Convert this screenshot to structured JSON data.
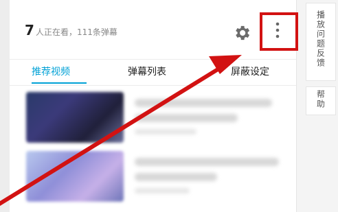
{
  "header": {
    "viewer_count": "7",
    "viewer_text": "人正在看，111条弹幕"
  },
  "tabs": [
    {
      "label": "推荐视频",
      "active": true
    },
    {
      "label": "弹幕列表",
      "active": false
    },
    {
      "label": "屏蔽设定",
      "active": false
    }
  ],
  "side_rail": {
    "feedback_label": "播放问题反馈",
    "help_label": "帮助"
  },
  "colors": {
    "accent": "#00a1d6",
    "annotation_red": "#d21212"
  },
  "icons": {
    "settings": "gear-icon",
    "more": "more-vertical-icon"
  }
}
